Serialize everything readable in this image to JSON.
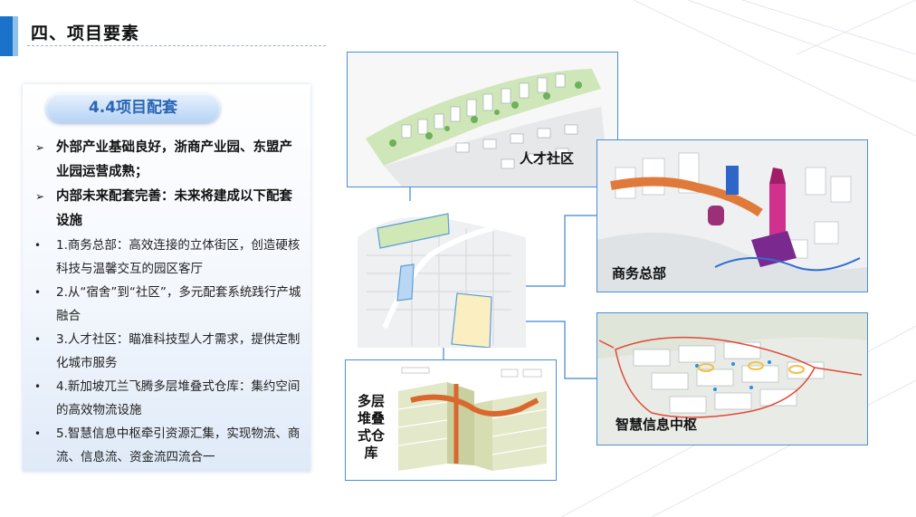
{
  "header": {
    "title": "四、项目要素"
  },
  "panel": {
    "heading": "4.4项目配套",
    "items": [
      {
        "type": "arrow",
        "text": "外部产业基础良好，浙商产业园、东盟产业园运营成熟；"
      },
      {
        "type": "arrow",
        "text": "内部未来配套完善：未来将建成以下配套设施"
      },
      {
        "type": "dot",
        "text": "1.商务总部：高效连接的立体街区，创造硬核科技与温馨交互的园区客厅"
      },
      {
        "type": "dot",
        "text": "2.从“宿舍”到“社区”，多元配套系统践行产城融合"
      },
      {
        "type": "dot",
        "text": "3.人才社区：瞄准科技型人才需求，提供定制化城市服务"
      },
      {
        "type": "dot",
        "text": "4.新加坡兀兰飞腾多层堆叠式仓库：集约空间的高效物流设施"
      },
      {
        "type": "dot",
        "text": "5.智慧信息中枢牵引资源汇集，实现物流、商流、信息流、资金流四流合一"
      }
    ]
  },
  "images": {
    "talent_label": "人才社区",
    "business_label": "商务总部",
    "hub_label": "智慧信息中枢",
    "warehouse_label": "多层堆叠式仓库"
  },
  "colors": {
    "accent": "#1a73c9",
    "frame": "#4a8fd4"
  }
}
